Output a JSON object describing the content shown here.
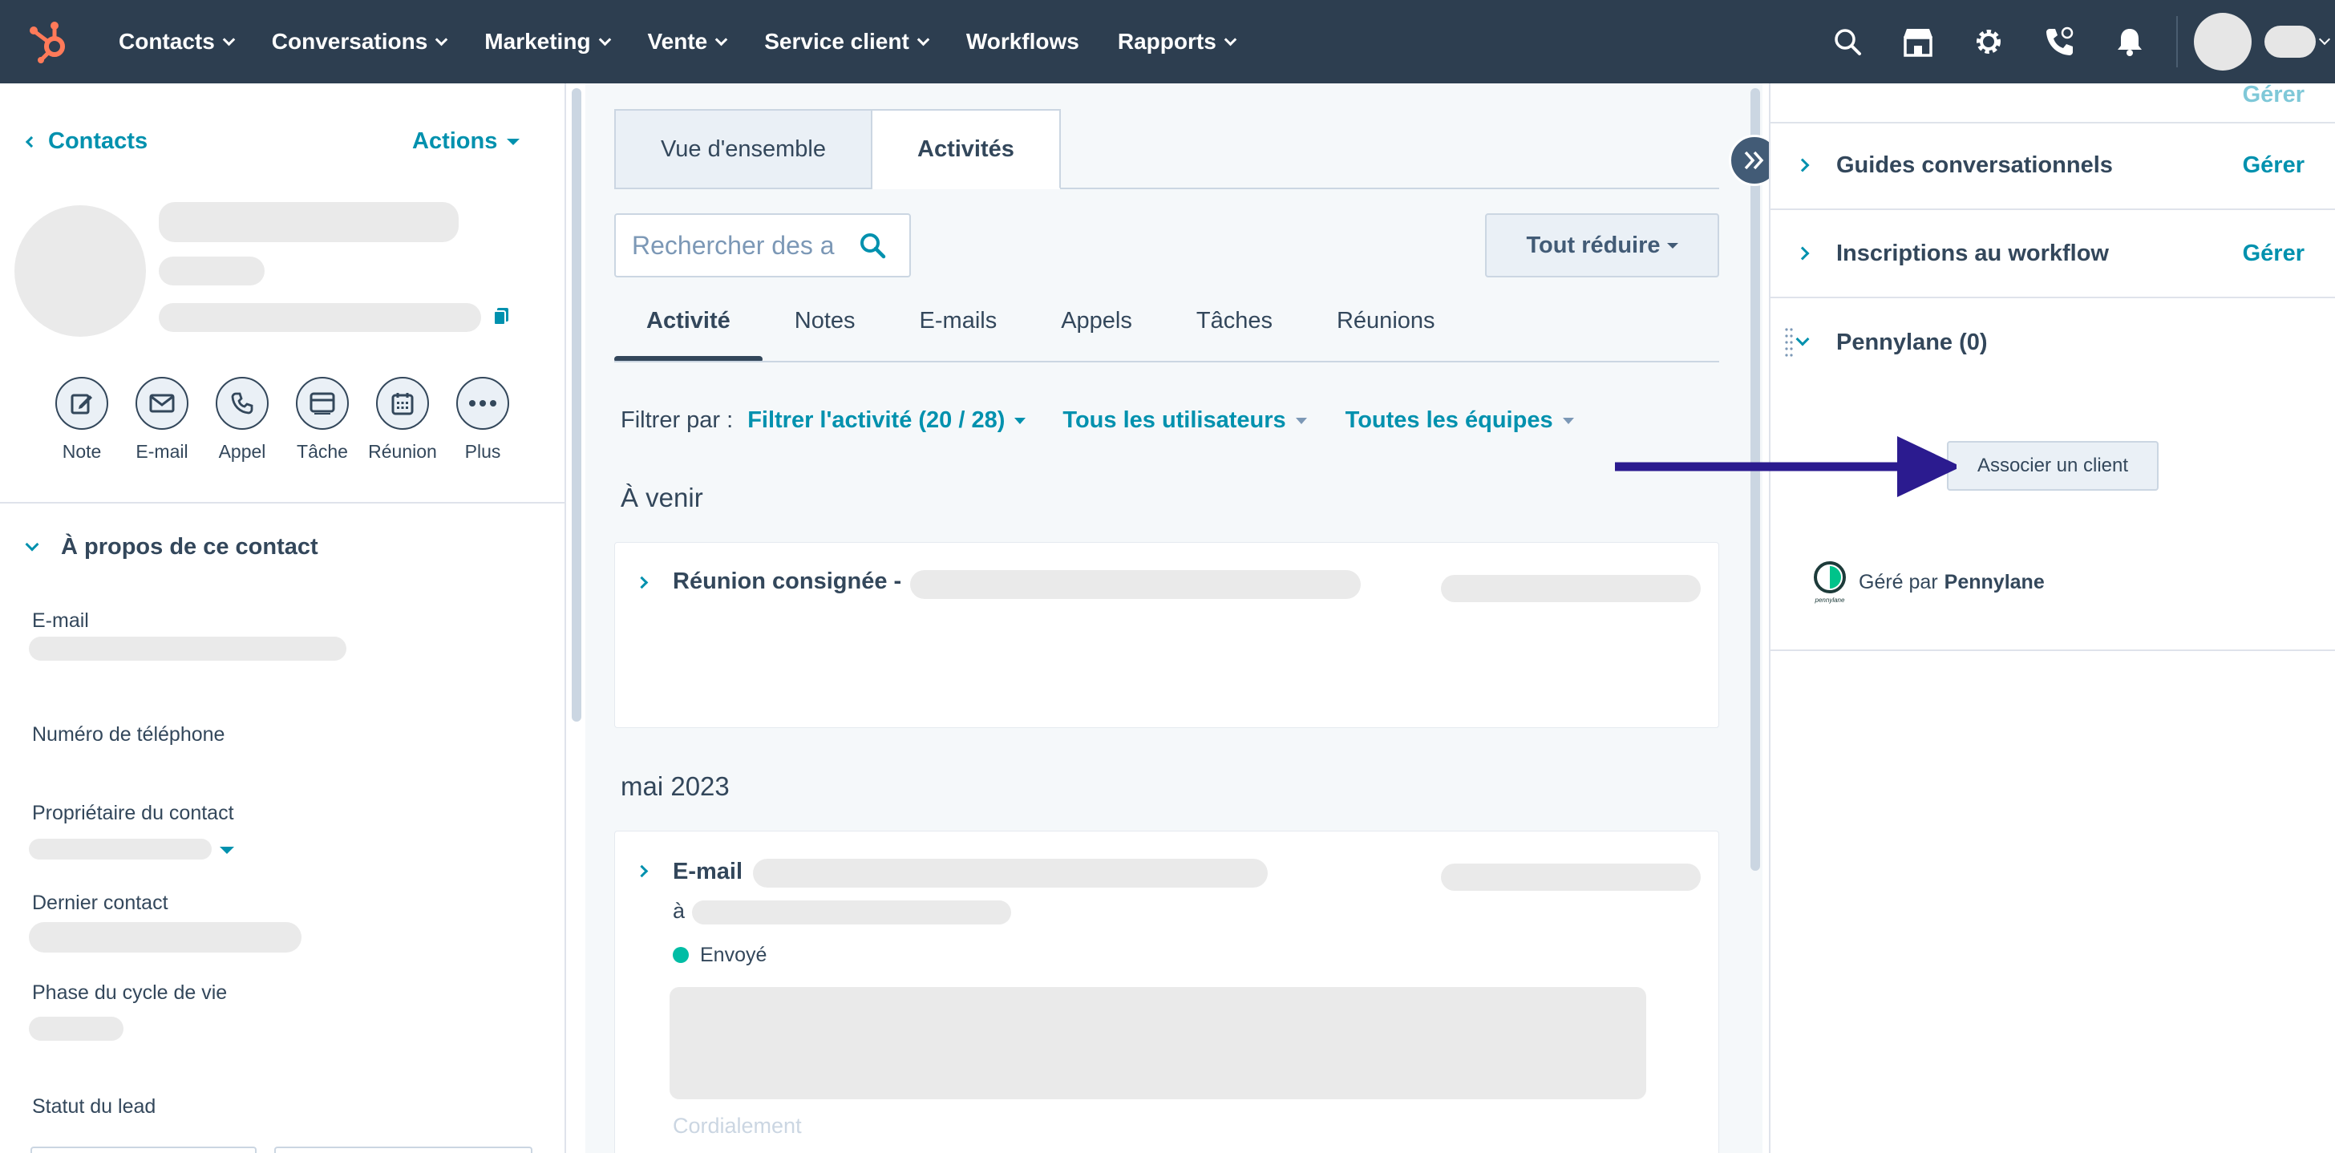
{
  "nav": {
    "items": [
      {
        "label": "Contacts",
        "caret": true
      },
      {
        "label": "Conversations",
        "caret": true
      },
      {
        "label": "Marketing",
        "caret": true
      },
      {
        "label": "Vente",
        "caret": true
      },
      {
        "label": "Service client",
        "caret": true
      },
      {
        "label": "Workflows",
        "caret": false
      },
      {
        "label": "Rapports",
        "caret": true
      }
    ],
    "icons": [
      "search-icon",
      "marketplace-icon",
      "settings-icon",
      "calling-icon",
      "notifications-icon"
    ],
    "brand_color": "#ff7a59"
  },
  "left": {
    "back_label": "Contacts",
    "actions_label": "Actions",
    "quick_actions": [
      {
        "label": "Note",
        "icon": "note-icon"
      },
      {
        "label": "E-mail",
        "icon": "email-icon"
      },
      {
        "label": "Appel",
        "icon": "call-icon"
      },
      {
        "label": "Tâche",
        "icon": "task-icon"
      },
      {
        "label": "Réunion",
        "icon": "meeting-icon"
      },
      {
        "label": "Plus",
        "icon": "more-icon"
      }
    ],
    "about_title": "À propos de ce contact",
    "properties": {
      "email": "E-mail",
      "phone": "Numéro de téléphone",
      "owner": "Propriétaire du contact",
      "last_contact": "Dernier contact",
      "lifecycle": "Phase du cycle de vie",
      "lead_status": "Statut du lead"
    }
  },
  "middle": {
    "tabs": [
      "Vue d'ensemble",
      "Activités"
    ],
    "active_tab": "Activités",
    "search_placeholder": "Rechercher des a",
    "collapse_label": "Tout réduire",
    "subtabs": [
      "Activité",
      "Notes",
      "E-mails",
      "Appels",
      "Tâches",
      "Réunions"
    ],
    "filter_label": "Filtrer par :",
    "filter_activity": "Filtrer l'activité (20 / 28)",
    "filter_users": "Tous les utilisateurs",
    "filter_teams": "Toutes les équipes",
    "upcoming_title": "À venir",
    "meeting_title": "Réunion consignée -",
    "month_title": "mai 2023",
    "email_title": "E-mail",
    "email_to": "à",
    "email_status": "Envoyé",
    "email_preview": "Cordialement"
  },
  "right": {
    "rows": [
      {
        "title": "Guides conversationnels",
        "manage": "Gérer"
      },
      {
        "title": "Inscriptions au workflow",
        "manage": "Gérer"
      }
    ],
    "pennylane_title": "Pennylane (0)",
    "associate_button": "Associer un client",
    "managed_by": "Géré par",
    "managed_brand": "Pennylane",
    "top_partial_manage": "Gérer"
  },
  "annotation_color": "#2b1b8f"
}
